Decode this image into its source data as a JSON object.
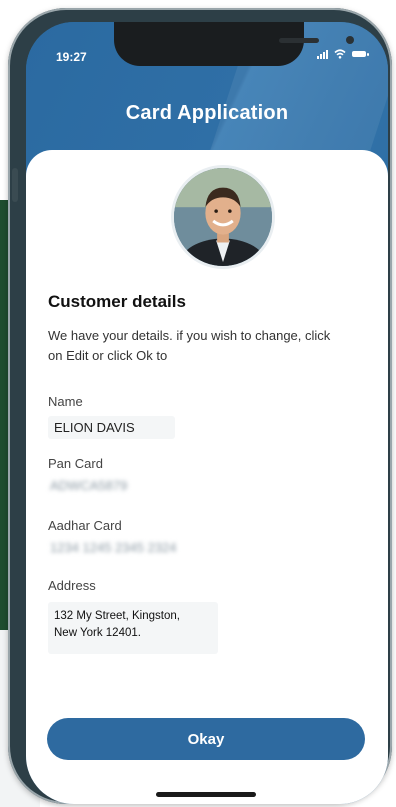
{
  "status_bar": {
    "time": "19:27"
  },
  "header": {
    "title": "Card Application"
  },
  "customer": {
    "section_title": "Customer details",
    "description": "We have your details. if you wish to change, click on Edit or click Ok to",
    "fields": [
      {
        "label": "Name",
        "value": "ELION DAVIS"
      },
      {
        "label": "Pan Card",
        "value": "ADWCA5879"
      },
      {
        "label": "Aadhar Card",
        "value": "1234 1245 2345 2324"
      },
      {
        "label": "Address",
        "value_line1": "132 My Street, Kingston,",
        "value_line2": "New York 12401."
      }
    ]
  },
  "actions": {
    "okay_label": "Okay"
  },
  "colors": {
    "accent": "#2e6aa0",
    "header": "#2f6c9e",
    "frame": "#2d3f47"
  }
}
